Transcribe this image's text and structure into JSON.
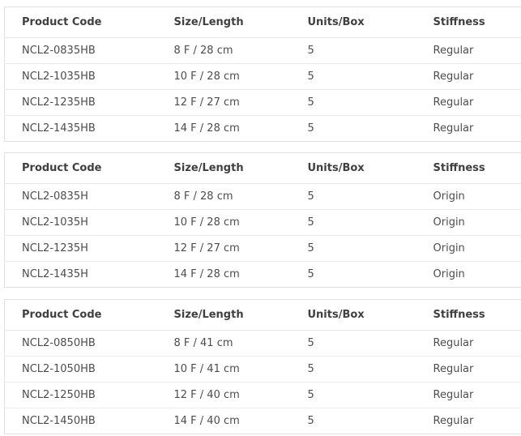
{
  "headers": [
    "Product Code",
    "Size/Length",
    "Units/Box",
    "Stiffness"
  ],
  "tables": [
    {
      "rows": [
        [
          "NCL2-0835HB",
          "8 F / 28 cm",
          "5",
          "Regular"
        ],
        [
          "NCL2-1035HB",
          "10 F / 28 cm",
          "5",
          "Regular"
        ],
        [
          "NCL2-1235HB",
          "12 F / 27 cm",
          "5",
          "Regular"
        ],
        [
          "NCL2-1435HB",
          "14 F / 28 cm",
          "5",
          "Regular"
        ]
      ]
    },
    {
      "rows": [
        [
          "NCL2-0835H",
          "8 F / 28 cm",
          "5",
          "Origin"
        ],
        [
          "NCL2-1035H",
          "10 F / 28 cm",
          "5",
          "Origin"
        ],
        [
          "NCL2-1235H",
          "12 F / 27 cm",
          "5",
          "Origin"
        ],
        [
          "NCL2-1435H",
          "14 F / 28 cm",
          "5",
          "Origin"
        ]
      ]
    },
    {
      "rows": [
        [
          "NCL2-0850HB",
          "8 F / 41 cm",
          "5",
          "Regular"
        ],
        [
          "NCL2-1050HB",
          "10 F / 41 cm",
          "5",
          "Regular"
        ],
        [
          "NCL2-1250HB",
          "12 F / 40 cm",
          "5",
          "Regular"
        ],
        [
          "NCL2-1450HB",
          "14 F / 40 cm",
          "5",
          "Regular"
        ]
      ]
    }
  ]
}
